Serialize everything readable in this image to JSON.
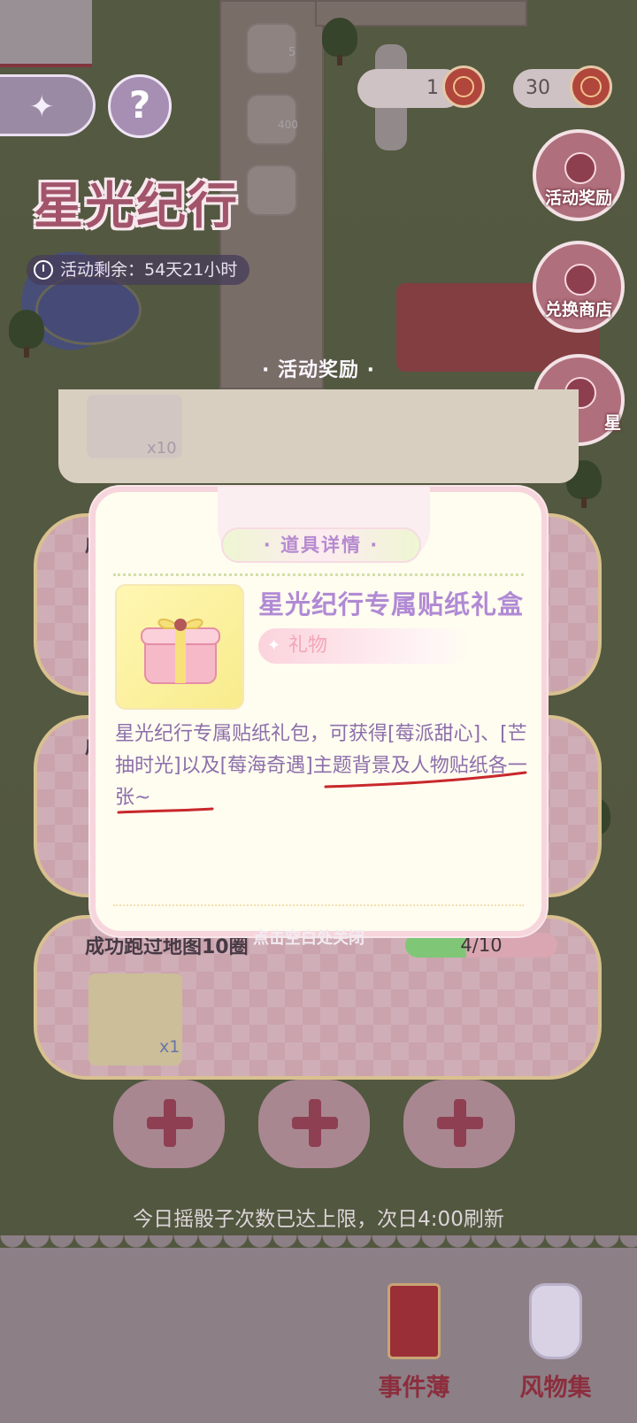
{
  "hud": {
    "event_title": "星光纪行",
    "timer_text": "活动剩余：54天21小时",
    "help_label": "?",
    "counter_a": "1",
    "counter_b": "30",
    "map_count_a": "5",
    "map_count_b": "400"
  },
  "side_buttons": [
    {
      "label": "活动奖励",
      "icon": "trophy-icon"
    },
    {
      "label": "兑换商店",
      "icon": "scale-icon"
    },
    {
      "label": "星",
      "icon": "star-badge-icon"
    }
  ],
  "rewards_panel": {
    "title": "活动奖励",
    "top_item_qty": "x10",
    "tasks": [
      {
        "title": "成"
      },
      {
        "title": "成"
      },
      {
        "title": "成功跑过地图10圈",
        "progress_text": "4/10",
        "progress": 0.4,
        "reward_qty": "x1"
      }
    ]
  },
  "modal": {
    "header": "· 道具详情 ·",
    "item_name": "星光纪行专属贴纸礼盒",
    "item_type": "礼物",
    "description": "星光纪行专属贴纸礼包，可获得[莓派甜心]、[芒抽时光]以及[莓海奇遇]主题背景及人物贴纸各一张~",
    "close_hint": "点击空白处关闭"
  },
  "notice": "今日摇骰子次数已达上限，次日4:00刷新",
  "bottom_nav": [
    {
      "label": "事件薄",
      "icon": "book-icon"
    },
    {
      "label": "风物集",
      "icon": "bottle-icon"
    }
  ],
  "colors": {
    "accent_purple": "#b08ad4",
    "pink_border": "#f7d5dc",
    "progress_fill": "#7fc776",
    "underline_red": "#c8282c"
  }
}
